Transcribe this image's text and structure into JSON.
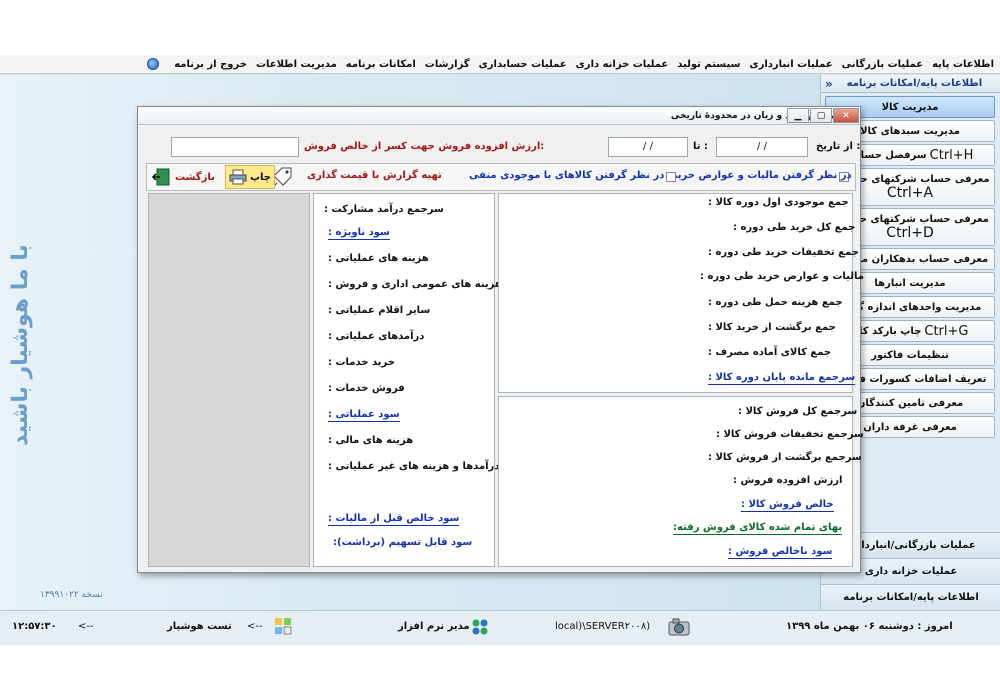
{
  "menu": {
    "items": [
      "اطلاعات پایه",
      "عملیات بازرگانی",
      "عملیات انبارداری",
      "سیستم تولید",
      "عملیات خزانه داری",
      "عملیات حسابداری",
      "گزارشات",
      "امکانات برنامه",
      "مدیریت اطلاعات",
      "خروج از برنامه"
    ]
  },
  "desktop": {
    "watermark": "با ما هوشیار باشید",
    "version": "نسخه ۱۳۹۹۱۰۲۲"
  },
  "right_panel": {
    "header": "اطلاعات پایه/امکانات برنامه",
    "collapse": "«",
    "items": [
      {
        "label": "مدیریت کالا",
        "shortcut": ""
      },
      {
        "label": "مدیریت سبدهای کالا",
        "shortcut": ""
      },
      {
        "label": "سرفصل حسابها",
        "shortcut": "Ctrl+H"
      },
      {
        "label": "معرفی حساب شرکتهای حقوقی",
        "shortcut": "Ctrl+A"
      },
      {
        "label": "معرفی حساب شرکتهای حقیقی",
        "shortcut": "Ctrl+D"
      },
      {
        "label": "معرفی حساب بدهکاران متفرقه",
        "shortcut": ""
      },
      {
        "label": "مدیریت انبارها",
        "shortcut": ""
      },
      {
        "label": "مدیریت واحدهای اندازه گیری",
        "shortcut": ""
      },
      {
        "label": "چاپ بارکد کالا",
        "shortcut": "Ctrl+G"
      },
      {
        "label": "تنظیمات فاکتور",
        "shortcut": ""
      },
      {
        "label": "تعریف اضافات کسورات فاکتور",
        "shortcut": ""
      },
      {
        "label": "معرفی تامین کنندگان",
        "shortcut": ""
      },
      {
        "label": "معرفی غرفه داران",
        "shortcut": ""
      }
    ],
    "bottom_items": [
      "عملیات بازرگانی/انبارداری",
      "عملیات خزانه داری",
      "اطلاعات پایه/امکانات برنامه"
    ]
  },
  "dialog": {
    "title": "گزارش سود و زیان در محدودهٔ تاریخی",
    "from_label": "از تاریخ :",
    "from_value": "/  /",
    "to_label": "تا :",
    "to_value": "/  /",
    "vat_label": "ارزش افزوده فروش جهت کسر از خالص فروش:",
    "vat_value": "",
    "chk_taxes_label": "در نظر گرفتن مالیات و عوارض خرید",
    "chk_negative_label": "در نظر گرفتن کالاهای با موجودی منفی",
    "price_label": "تهیه گزارش با قیمت گذاری",
    "print_label": "چاپ",
    "back_label": "بازگشت",
    "purchase_items": [
      "جمع موجودی اول دوره کالا :",
      "جمع کل خرید طی دوره :",
      "جمع تخفیفات خرید طی دوره :",
      "مالیات و عوارض خرید طی دوره :",
      "جمع هزینه حمل طی دوره :",
      "جمع برگشت از خرید کالا :",
      "جمع کالای آماده مصرف :"
    ],
    "purchase_total": "سرجمع مانده پایان دوره کالا :",
    "sales_items": [
      "سرجمع کل فروش کالا :",
      "سرجمع تخفیفات فروش کالا :",
      "سرجمع برگشت از فروش کالا :",
      "ارزش افزوده فروش :"
    ],
    "net_sales": "خالص فروش کالا :",
    "cogs": "بهای تمام شده کالای فروش رفته:",
    "gross_profit": "سود ناخالص فروش :",
    "left_items": [
      {
        "text": "سرجمع درآمد مشارکت :",
        "style": "normal"
      },
      {
        "text": "سود ناویژه :",
        "style": "blue"
      },
      {
        "text": "هزینه های عملیاتی :",
        "style": "normal"
      },
      {
        "text": "هزینه های عمومی اداری و فروش :",
        "style": "normal"
      },
      {
        "text": "سایر اقلام عملیاتی :",
        "style": "normal"
      },
      {
        "text": "درآمدهای عملیاتی :",
        "style": "normal"
      },
      {
        "text": "خرید خدمات :",
        "style": "normal"
      },
      {
        "text": "فروش خدمات :",
        "style": "normal"
      },
      {
        "text": "سود عملیاتی :",
        "style": "blue"
      },
      {
        "text": "هزینه های مالی :",
        "style": "normal"
      },
      {
        "text": "سایر درآمدها و هزینه های غیر عملیاتی :",
        "style": "normal"
      }
    ],
    "pretax_profit": "سود خالص قبل از مالیات :",
    "distributable": "سود قابل تسهیم (برداشت):"
  },
  "status": {
    "date": "امروز : دوشنبه ۰۶ بهمن ماه ۱۳۹۹",
    "server": "local)\\SERVER۲۰۰۸)",
    "role": "مدیر نرم افزار",
    "arrow1": "<--",
    "user": "تست هوشیار",
    "arrow2": "<--",
    "time": "۱۲:۵۷:۳۰"
  }
}
